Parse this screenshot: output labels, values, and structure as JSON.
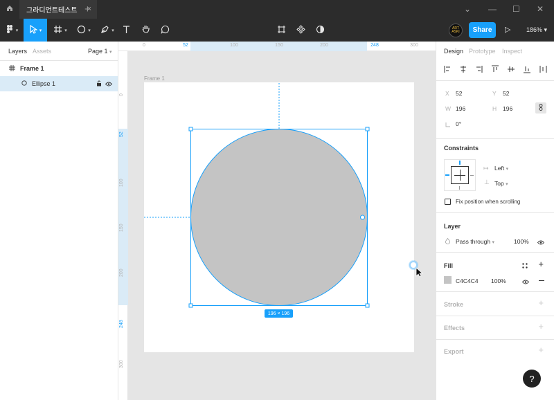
{
  "window": {
    "tab_title": "그라디언트테스트",
    "tab_close": "×",
    "new_tab": "+",
    "min": "⌄",
    "minimize": "—",
    "maximize": "☐",
    "close": "✕"
  },
  "toolbar": {
    "share_label": "Share",
    "zoom_label": "186%",
    "avatar_text": "ART ASKI",
    "play_symbol": "▷"
  },
  "left_panel": {
    "tabs": [
      "Layers",
      "Assets"
    ],
    "page_label": "Page 1",
    "layers": [
      {
        "name": "Frame 1",
        "type": "frame"
      },
      {
        "name": "Ellipse 1",
        "type": "ellipse",
        "selected": true
      }
    ]
  },
  "canvas": {
    "frame_label": "Frame 1",
    "size_badge": "196 × 196",
    "ruler_top": [
      "0",
      "52",
      "100",
      "150",
      "200",
      "248",
      "300"
    ],
    "ruler_left": [
      "0",
      "52",
      "100",
      "150",
      "200",
      "248",
      "300"
    ]
  },
  "right_panel": {
    "tabs": [
      "Design",
      "Prototype",
      "Inspect"
    ],
    "transform": {
      "x_label": "X",
      "x_value": "52",
      "y_label": "Y",
      "y_value": "52",
      "w_label": "W",
      "w_value": "196",
      "h_label": "H",
      "h_value": "196",
      "rotation": "0°"
    },
    "constraints": {
      "title": "Constraints",
      "horizontal": "Left",
      "vertical": "Top",
      "fix_position_label": "Fix position when scrolling"
    },
    "layer": {
      "title": "Layer",
      "blend_mode": "Pass through",
      "opacity": "100%"
    },
    "fill": {
      "title": "Fill",
      "color_hex": "C4C4C4",
      "opacity": "100%",
      "swatch": "#C4C4C4"
    },
    "stroke_title": "Stroke",
    "effects_title": "Effects",
    "export_title": "Export"
  },
  "help_label": "?",
  "colors": {
    "accent": "#18a0fb",
    "ellipse_fill": "#C4C4C4",
    "dark_bar": "#2c2c2c"
  }
}
